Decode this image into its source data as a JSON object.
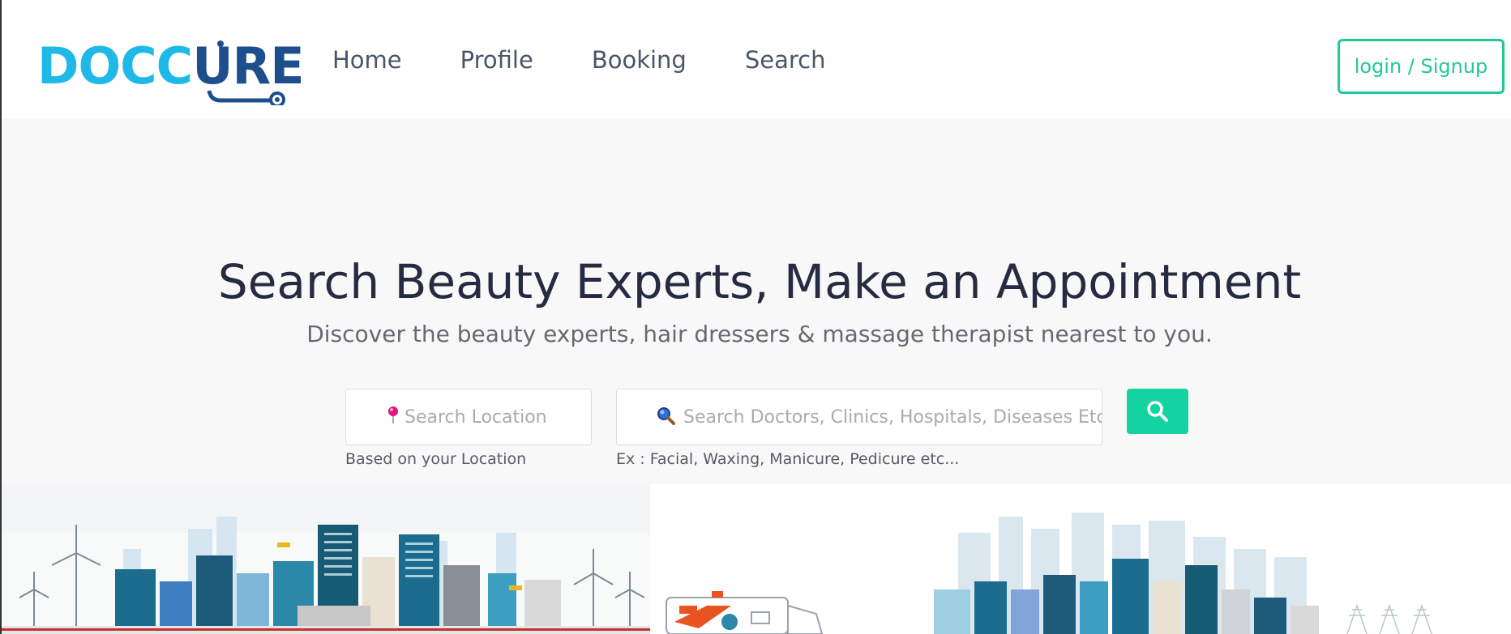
{
  "brand": {
    "logo_part_1": "DOCC",
    "logo_part_2": "U",
    "logo_part_3": "RE",
    "colors": {
      "cyan": "#1fb9e8",
      "navy": "#1d4f8c",
      "accent": "#20c997"
    }
  },
  "nav": {
    "items": [
      {
        "label": "Home"
      },
      {
        "label": "Profile"
      },
      {
        "label": "Booking"
      },
      {
        "label": "Search"
      }
    ]
  },
  "auth": {
    "login_label": "login / Signup"
  },
  "hero": {
    "title": "Search Beauty Experts, Make an Appointment",
    "subtitle": "Discover the beauty experts, hair dressers & massage therapist nearest to you.",
    "location": {
      "placeholder": "Search Location",
      "value": "",
      "hint": "Based on your Location",
      "icon": "map-pin-icon"
    },
    "search": {
      "placeholder": "Search Doctors, Clinics, Hospitals, Diseases Etc",
      "value": "",
      "hint": "Ex : Facial, Waxing, Manicure, Pedicure etc...",
      "icon": "magnifier-icon"
    },
    "search_button_icon": "search-icon"
  },
  "illustration": {
    "icon": "city-skyline-illustration"
  }
}
